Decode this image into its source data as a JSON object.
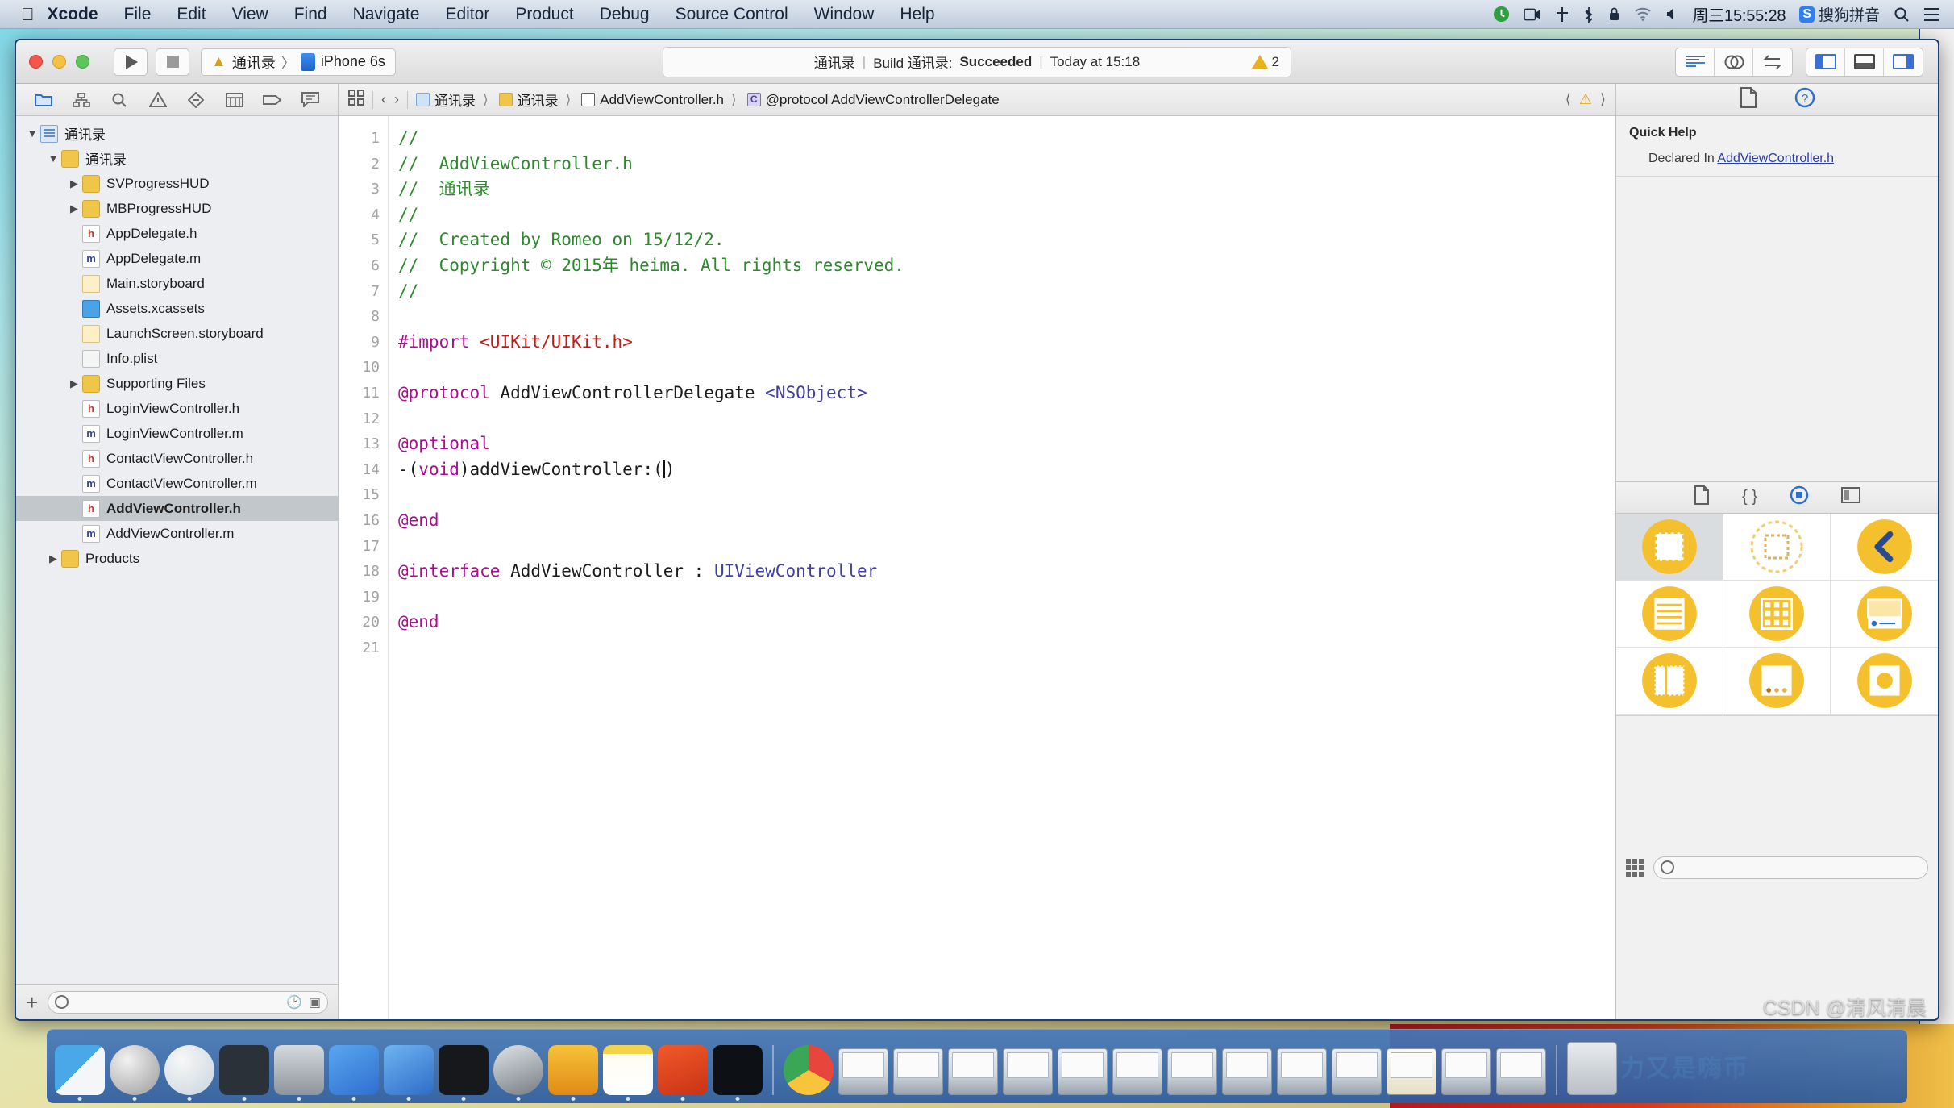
{
  "menubar": {
    "apple_icon": "apple-icon",
    "items": [
      "Xcode",
      "File",
      "Edit",
      "View",
      "Find",
      "Navigate",
      "Editor",
      "Product",
      "Debug",
      "Source Control",
      "Window",
      "Help"
    ],
    "status_icons": [
      "time-machine-icon",
      "screen-recording-icon",
      "airplay-icon",
      "bluetooth-icon",
      "lock-icon",
      "wifi-icon",
      "volume-icon"
    ],
    "clock": "周三15:55:28",
    "input_method_badge": "S",
    "input_method": "搜狗拼音",
    "search_icon": "search-icon",
    "notification_icon": "list-icon"
  },
  "toolbar": {
    "run_label": "run-button",
    "stop_label": "stop-button",
    "scheme_target": "通讯录",
    "scheme_separator": "〉",
    "scheme_device": "iPhone 6s",
    "activity": {
      "project": "通讯录",
      "sep1": "|",
      "action": "Build 通讯录:",
      "result": "Succeeded",
      "sep2": "|",
      "time": "Today at 15:18",
      "warning_count": "2"
    },
    "editor_modes": [
      "standard-editor",
      "assistant-editor",
      "version-editor"
    ],
    "view_toggles": [
      "navigator-toggle",
      "debug-area-toggle",
      "utilities-toggle"
    ]
  },
  "navigator": {
    "tabs": [
      "project-navigator",
      "symbol-navigator",
      "find-navigator",
      "issue-navigator",
      "test-navigator",
      "debug-navigator",
      "breakpoint-navigator",
      "report-navigator"
    ],
    "active_tab_index": 0,
    "tree": [
      {
        "label": "通讯录",
        "indent": 0,
        "icon": "project-icon",
        "twisty": "▼"
      },
      {
        "label": "通讯录",
        "indent": 1,
        "icon": "folder-icon",
        "twisty": "▼"
      },
      {
        "label": "SVProgressHUD",
        "indent": 2,
        "icon": "folder-icon",
        "twisty": "▶"
      },
      {
        "label": "MBProgressHUD",
        "indent": 2,
        "icon": "folder-icon",
        "twisty": "▶"
      },
      {
        "label": "AppDelegate.h",
        "indent": 2,
        "icon": "header-file-icon",
        "twisty": ""
      },
      {
        "label": "AppDelegate.m",
        "indent": 2,
        "icon": "source-file-icon",
        "twisty": ""
      },
      {
        "label": "Main.storyboard",
        "indent": 2,
        "icon": "storyboard-icon",
        "twisty": ""
      },
      {
        "label": "Assets.xcassets",
        "indent": 2,
        "icon": "assets-icon",
        "twisty": ""
      },
      {
        "label": "LaunchScreen.storyboard",
        "indent": 2,
        "icon": "storyboard-icon",
        "twisty": ""
      },
      {
        "label": "Info.plist",
        "indent": 2,
        "icon": "plist-icon",
        "twisty": ""
      },
      {
        "label": "Supporting Files",
        "indent": 2,
        "icon": "folder-icon",
        "twisty": "▶"
      },
      {
        "label": "LoginViewController.h",
        "indent": 2,
        "icon": "header-file-icon",
        "twisty": ""
      },
      {
        "label": "LoginViewController.m",
        "indent": 2,
        "icon": "source-file-icon",
        "twisty": ""
      },
      {
        "label": "ContactViewController.h",
        "indent": 2,
        "icon": "header-file-icon",
        "twisty": ""
      },
      {
        "label": "ContactViewController.m",
        "indent": 2,
        "icon": "source-file-icon",
        "twisty": ""
      },
      {
        "label": "AddViewController.h",
        "indent": 2,
        "icon": "header-file-icon",
        "twisty": "",
        "selected": true
      },
      {
        "label": "AddViewController.m",
        "indent": 2,
        "icon": "source-file-icon",
        "twisty": ""
      },
      {
        "label": "Products",
        "indent": 1,
        "icon": "folder-icon",
        "twisty": "▶"
      }
    ],
    "bottom": {
      "add_label": "+",
      "filter_placeholder": "",
      "recent_icon": "clock-icon",
      "focus_icon": "focus-icon"
    }
  },
  "editor": {
    "jumpbar": {
      "related_icon": "related-items-icon",
      "back_icon": "chevron-left-icon",
      "forward_icon": "chevron-right-icon",
      "crumbs": [
        {
          "label": "通讯录",
          "icon": "project-icon"
        },
        {
          "label": "通讯录",
          "icon": "folder-icon"
        },
        {
          "label": "AddViewController.h",
          "icon": "header-file-icon"
        },
        {
          "label": "@protocol AddViewControllerDelegate",
          "icon": "protocol-icon"
        }
      ],
      "warning_icon": "warning-icon",
      "prev_issue_icon": "chevron-left-icon",
      "next_issue_icon": "chevron-right-icon"
    },
    "filename": "AddViewController.h",
    "first_line": 1,
    "last_line": 21,
    "lines": [
      {
        "n": 1,
        "tokens": [
          {
            "t": "//",
            "c": "cm"
          }
        ]
      },
      {
        "n": 2,
        "tokens": [
          {
            "t": "//  AddViewController.h",
            "c": "cm"
          }
        ]
      },
      {
        "n": 3,
        "tokens": [
          {
            "t": "//  通讯录",
            "c": "cm"
          }
        ]
      },
      {
        "n": 4,
        "tokens": [
          {
            "t": "//",
            "c": "cm"
          }
        ]
      },
      {
        "n": 5,
        "tokens": [
          {
            "t": "//  Created by Romeo on 15/12/2.",
            "c": "cm"
          }
        ]
      },
      {
        "n": 6,
        "tokens": [
          {
            "t": "//  Copyright © 2015年 heima. All rights reserved.",
            "c": "cm"
          }
        ]
      },
      {
        "n": 7,
        "tokens": [
          {
            "t": "//",
            "c": "cm"
          }
        ]
      },
      {
        "n": 8,
        "tokens": []
      },
      {
        "n": 9,
        "tokens": [
          {
            "t": "#import ",
            "c": "kw"
          },
          {
            "t": "<UIKit/UIKit.h>",
            "c": "str"
          }
        ]
      },
      {
        "n": 10,
        "tokens": []
      },
      {
        "n": 11,
        "tokens": [
          {
            "t": "@protocol",
            "c": "kw"
          },
          {
            "t": " AddViewControllerDelegate ",
            "c": "pln"
          },
          {
            "t": "<NSObject>",
            "c": "typ"
          }
        ]
      },
      {
        "n": 12,
        "tokens": []
      },
      {
        "n": 13,
        "tokens": [
          {
            "t": "@optional",
            "c": "kw"
          }
        ]
      },
      {
        "n": 14,
        "tokens": [
          {
            "t": "-(",
            "c": "pln"
          },
          {
            "t": "void",
            "c": "kw"
          },
          {
            "t": ")addViewController:(",
            "c": "pln"
          },
          {
            "t": "CARET",
            "c": "caret"
          },
          {
            "t": ")",
            "c": "pln"
          }
        ]
      },
      {
        "n": 15,
        "tokens": []
      },
      {
        "n": 16,
        "tokens": [
          {
            "t": "@end",
            "c": "kw"
          }
        ]
      },
      {
        "n": 17,
        "tokens": []
      },
      {
        "n": 18,
        "tokens": [
          {
            "t": "@interface",
            "c": "kw"
          },
          {
            "t": " AddViewController : ",
            "c": "pln"
          },
          {
            "t": "UIViewController",
            "c": "typ"
          }
        ]
      },
      {
        "n": 19,
        "tokens": []
      },
      {
        "n": 20,
        "tokens": [
          {
            "t": "@end",
            "c": "kw"
          }
        ]
      },
      {
        "n": 21,
        "tokens": []
      }
    ]
  },
  "utility": {
    "tabs": [
      "file-inspector",
      "quick-help-inspector"
    ],
    "active_tab_index": 1,
    "quick_help": {
      "title": "Quick Help",
      "label": "Declared In",
      "value": "AddViewController.h"
    },
    "library": {
      "tabs": [
        "file-template-library",
        "code-snippet-library",
        "object-library",
        "media-library"
      ],
      "active_tab_index": 2,
      "items": [
        {
          "name": "view-object",
          "selected": true
        },
        {
          "name": "view-controller-placeholder-object",
          "selected": false
        },
        {
          "name": "navigation-back-object",
          "selected": false
        },
        {
          "name": "table-view-object",
          "selected": false
        },
        {
          "name": "collection-view-object",
          "selected": false
        },
        {
          "name": "search-bar-object",
          "selected": false
        },
        {
          "name": "split-view-object",
          "selected": false
        },
        {
          "name": "page-control-object",
          "selected": false
        },
        {
          "name": "image-view-object",
          "selected": false
        }
      ],
      "filter_placeholder": ""
    }
  },
  "dock": {
    "apps": [
      "finder-icon",
      "launchpad-icon",
      "safari-icon",
      "sketchbook-icon",
      "quicktime-icon",
      "xcode-icon",
      "simulator-icon",
      "terminal-icon",
      "system-preferences-icon",
      "sketch-icon",
      "notes-icon",
      "pages-icon",
      "iterm-icon"
    ],
    "running_apps": [
      "chrome-icon"
    ],
    "window_thumbnails": 13,
    "trash": "trash-icon"
  },
  "watermark": "CSDN @清风清晨",
  "banner_text": "助力又是嗨币",
  "colors": {
    "accent_blue": "#2f6fd0",
    "comment_green": "#2b8a2b",
    "keyword_magenta": "#aa0d91",
    "string_red": "#c41a16",
    "type_purple": "#3f3fa0",
    "library_yellow": "#f5c02e",
    "warning_yellow": "#e9b21c",
    "selection_gray": "#c2c7cc"
  }
}
